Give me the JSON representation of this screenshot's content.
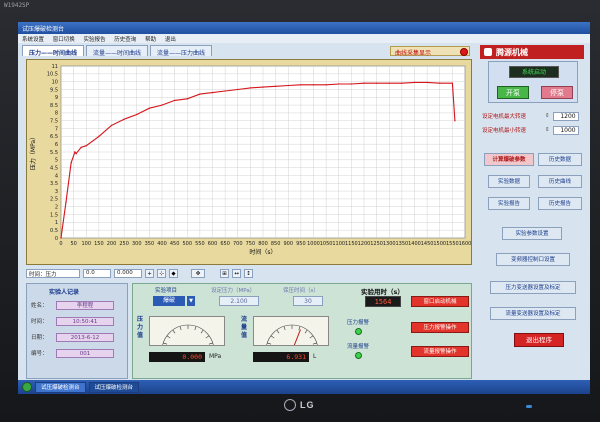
{
  "monitor": {
    "model_label": "W1942SP",
    "brand": "LG"
  },
  "window": {
    "title": "试压爆破检测台"
  },
  "menu": {
    "items": [
      "系统设置",
      "窗口切换",
      "实验报告",
      "历史查询",
      "帮助",
      "退出"
    ]
  },
  "tabs": [
    {
      "label": "压力——时间曲线",
      "active": true
    },
    {
      "label": "流量——时间曲线",
      "active": false
    },
    {
      "label": "流量——压力曲线",
      "active": false
    }
  ],
  "curve_display": {
    "label": "曲线采集显示",
    "led_color": "#e01818"
  },
  "brand_logo": {
    "text": "腾源机械"
  },
  "chart_data": {
    "type": "line",
    "xlabel": "时间（s）",
    "ylabel": "压力（MPa）",
    "x_ticks": [
      0,
      50,
      100,
      150,
      200,
      250,
      300,
      350,
      400,
      450,
      500,
      550,
      600,
      650,
      700,
      750,
      800,
      850,
      900,
      950,
      1000,
      1050,
      1100,
      1150,
      1200,
      1250,
      1300,
      1350,
      1400,
      1450,
      1500,
      1550,
      1600
    ],
    "y_ticks": [
      0,
      0.5,
      1,
      1.5,
      2,
      2.5,
      3,
      3.5,
      4,
      4.5,
      5,
      5.5,
      6,
      6.5,
      7,
      7.5,
      8,
      8.5,
      9,
      9.5,
      10,
      10.5,
      11
    ],
    "xlim": [
      0,
      1600
    ],
    "ylim": [
      0,
      11
    ],
    "grid": true,
    "series": [
      {
        "color": "#d4151b",
        "x": [
          0,
          20,
          40,
          55,
          60,
          80,
          100,
          150,
          200,
          250,
          300,
          350,
          400,
          450,
          500,
          550,
          600,
          650,
          700,
          750,
          800,
          850,
          900,
          950,
          1000,
          1050,
          1100,
          1150,
          1200,
          1250,
          1300,
          1350,
          1400,
          1450,
          1500,
          1550,
          1560
        ],
        "y": [
          0,
          2.3,
          4.8,
          5.5,
          5.4,
          5.8,
          5.9,
          6.5,
          7.2,
          7.6,
          7.9,
          8.3,
          8.5,
          8.8,
          8.9,
          9.2,
          9.3,
          9.4,
          9.5,
          9.6,
          9.65,
          9.7,
          9.75,
          9.8,
          9.8,
          9.8,
          9.85,
          9.85,
          9.9,
          9.9,
          9.9,
          9.9,
          9.95,
          9.95,
          9.9,
          9.9,
          7.5
        ]
      }
    ]
  },
  "chart_toolbar": {
    "channel_label": "时间：压力",
    "x_value": "0.0",
    "y_value": "0.000"
  },
  "right_panel": {
    "status_display": "系统启动",
    "start_label": "开泵",
    "stop_label": "停泵",
    "params": [
      {
        "label": "设定电机最大转速",
        "value": "1200"
      },
      {
        "label": "设定电机最小转速",
        "value": "1000"
      }
    ],
    "nav_buttons": [
      {
        "label": "计算爆破参数",
        "active": true
      },
      {
        "label": "历史数据",
        "active": false
      },
      {
        "label": "实验数据",
        "active": false
      },
      {
        "label": "历史曲线",
        "active": false
      },
      {
        "label": "实验报告",
        "active": false
      },
      {
        "label": "历史报告",
        "active": false
      }
    ],
    "setting_buttons": [
      "实验参数设置",
      "变频器控制口设置",
      "压力变送器设置及标定",
      "流量变送器设置及标定"
    ],
    "exit_label": "退出程序"
  },
  "record": {
    "title": "实验人记录",
    "rows": [
      {
        "label": "姓名：",
        "value": "李程程"
      },
      {
        "label": "时间：",
        "value": "10:50:41"
      },
      {
        "label": "日期：",
        "value": "2013-6-12"
      },
      {
        "label": "编号：",
        "value": "001"
      }
    ]
  },
  "experiment": {
    "project_label": "实验项目",
    "project_value": "爆破",
    "set_pressure_label": "设定压力（MPa）",
    "set_pressure_value": "2.100",
    "hold_time_label": "保压时间（s）",
    "hold_time_value": "30",
    "time_label": "实验用时（s）",
    "time_value": "1564",
    "pressure_gauge": {
      "label": "压力值",
      "reading": "0.000",
      "unit": "MPa",
      "level": 0
    },
    "flow_gauge": {
      "label": "流量值",
      "reading": "6.931",
      "unit": "L",
      "level": 0.62
    },
    "pressure_alarm_label": "压力报警",
    "flow_alarm_label": "流量报警",
    "alarm_led_color": "#3cd24a",
    "op_buttons": [
      "窗口启动机械",
      "压力报警操作",
      "流量报警操作"
    ]
  },
  "taskbar": {
    "items": [
      {
        "label": "试压爆破检测台",
        "active": false
      },
      {
        "label": "试压爆破检测台",
        "active": true
      }
    ]
  }
}
